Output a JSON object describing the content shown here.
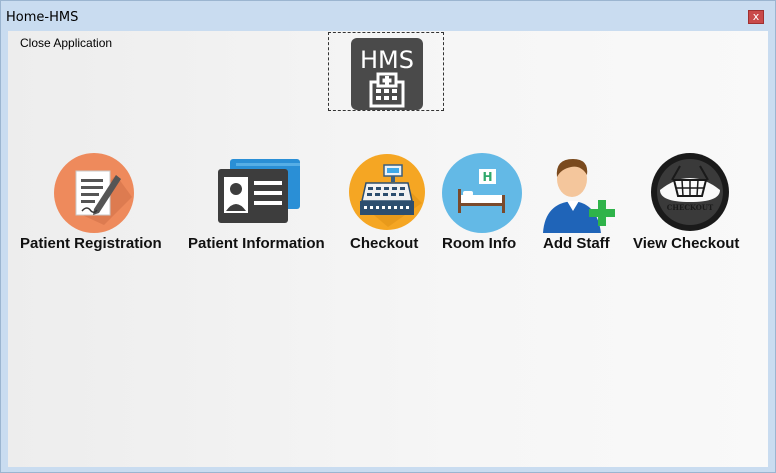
{
  "window": {
    "title": "Home-HMS",
    "close_glyph": "x"
  },
  "menu": {
    "close_application": "Close Application"
  },
  "logo": {
    "text": "HMS",
    "icon": "hospital-building-icon"
  },
  "tiles": [
    {
      "label": "Patient Registration",
      "icon": "patient-registration-icon"
    },
    {
      "label": "Patient Information",
      "icon": "id-card-icon"
    },
    {
      "label": "Checkout",
      "icon": "cash-register-icon"
    },
    {
      "label": "Room Info",
      "icon": "hospital-bed-icon"
    },
    {
      "label": "Add Staff",
      "icon": "add-user-icon"
    },
    {
      "label": "View Checkout",
      "icon": "checkout-basket-icon"
    }
  ]
}
